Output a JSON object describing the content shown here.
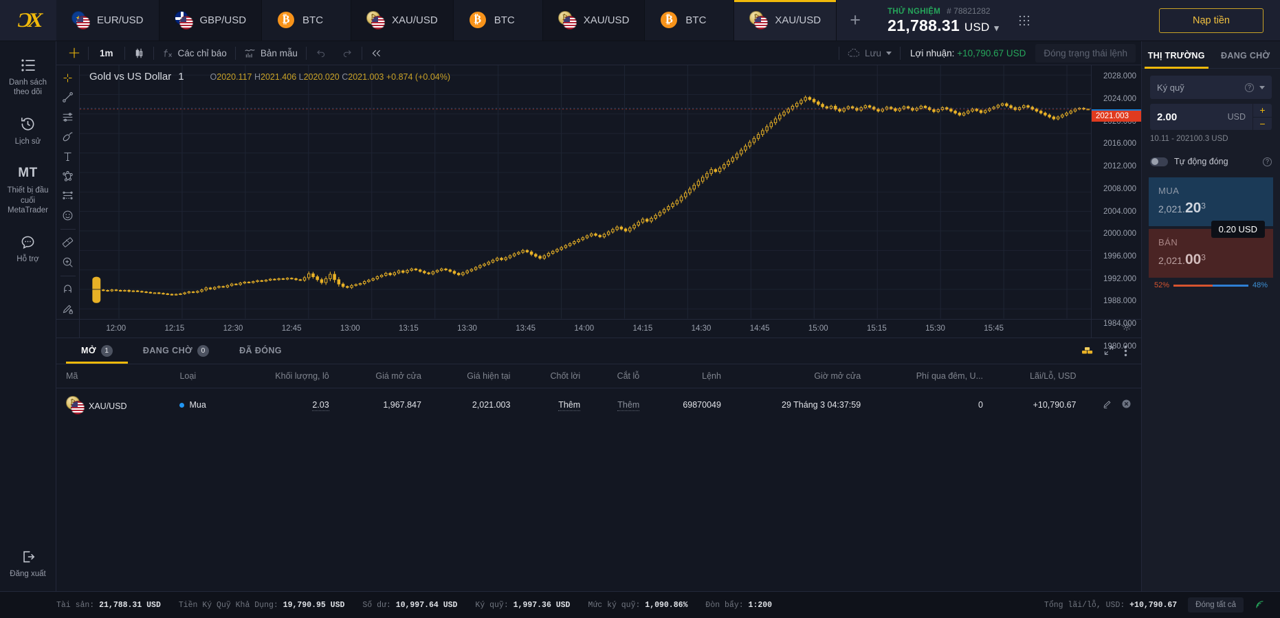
{
  "header": {
    "logo": "ex-logo",
    "tabs": [
      {
        "label": "EUR/USD",
        "icon": "eurusd-pair-icon",
        "active": false
      },
      {
        "label": "GBP/USD",
        "icon": "gbpusd-pair-icon",
        "active": false
      },
      {
        "label": "BTC",
        "icon": "btc-coin-icon",
        "active": false
      },
      {
        "label": "XAU/USD",
        "icon": "xauusd-pair-icon",
        "active": false
      },
      {
        "label": "BTC",
        "icon": "btc-coin-icon",
        "active": false
      },
      {
        "label": "XAU/USD",
        "icon": "xauusd-pair-icon",
        "active": false
      },
      {
        "label": "BTC",
        "icon": "btc-coin-icon",
        "active": false
      },
      {
        "label": "XAU/USD",
        "icon": "xauusd-pair-icon",
        "active": true
      }
    ],
    "add_tab": "+",
    "account_type": "THỬ NGHIỆM",
    "account_id": "# 78821282",
    "balance": "21,788.31",
    "balance_currency": "USD",
    "balance_caret": "▾",
    "apps_icon": "apps-grid-icon",
    "deposit_label": "Nạp tiền"
  },
  "sidebar": {
    "items": [
      {
        "label": "Danh sách theo dõi",
        "icon": "watchlist-icon"
      },
      {
        "label": "Lịch sử",
        "icon": "history-icon"
      },
      {
        "label": "Thiết bị đầu cuối MetaTrader",
        "icon": "mt-terminal-icon",
        "badge": "MT"
      },
      {
        "label": "Hỗ trợ",
        "icon": "support-chat-icon"
      }
    ],
    "logout": {
      "label": "Đăng xuất",
      "icon": "logout-icon"
    }
  },
  "chart_toolbar": {
    "crosshair_icon": "crosshair-icon",
    "timeframe": "1m",
    "chart_type_icon": "candlestick-type-icon",
    "indicators_label": "Các chỉ báo",
    "indicators_icon": "fx-icon",
    "templates_label": "Bản mẫu",
    "templates_icon": "template-icon",
    "undo_icon": "undo-icon",
    "redo_icon": "redo-icon",
    "replay_icon": "replay-icon",
    "save_label": "Lưu",
    "save_icon": "cloud-icon",
    "profit_label": "Lợi nhuận:",
    "profit_value": "+10,790.67 USD",
    "close_position_label": "Đóng trạng thái lệnh"
  },
  "draw_tools": [
    {
      "icon": "crosshair-cursor-icon",
      "active": true
    },
    {
      "icon": "trend-line-icon",
      "active": false
    },
    {
      "icon": "horizontal-lines-icon",
      "active": false
    },
    {
      "icon": "brush-icon",
      "active": false
    },
    {
      "icon": "text-icon",
      "active": false
    },
    {
      "icon": "pitchfork-icon",
      "active": false
    },
    {
      "icon": "fib-retracement-icon",
      "active": false
    },
    {
      "icon": "emoji-icon",
      "active": false
    },
    {
      "icon": "measure-ruler-icon",
      "active": false
    },
    {
      "icon": "zoom-in-icon",
      "active": false
    },
    {
      "icon": "magnet-icon",
      "active": false
    },
    {
      "icon": "pencil-lock-icon",
      "active": false
    }
  ],
  "chart_data": {
    "type": "line",
    "title": "Gold vs US Dollar",
    "interval": "1",
    "ohlc": {
      "o_label": "O",
      "o": "2020.117",
      "h_label": "H",
      "h": "2021.406",
      "l_label": "L",
      "l": "2020.020",
      "c_label": "C",
      "c": "2021.003",
      "change": "+0.874 (+0.04%)"
    },
    "xlabel": "",
    "ylabel": "",
    "ylim": [
      1978,
      2030
    ],
    "y_ticks": [
      "2028.000",
      "2024.000",
      "2020.000",
      "2016.000",
      "2012.000",
      "2008.000",
      "2004.000",
      "2000.000",
      "1996.000",
      "1992.000",
      "1988.000",
      "1984.000",
      "1980.000"
    ],
    "x_ticks": [
      "12:00",
      "12:15",
      "12:30",
      "12:45",
      "13:00",
      "13:15",
      "13:30",
      "13:45",
      "14:00",
      "14:15",
      "14:30",
      "14:45",
      "15:00",
      "15:15",
      "15:30",
      "15:45"
    ],
    "grid": true,
    "price_tags": [
      {
        "value": "2021.203",
        "color": "#1e7fd4"
      },
      {
        "value": "2021.003",
        "color": "#e03b1f"
      }
    ],
    "series": [
      {
        "name": "XAU/USD 1m close",
        "values": [
          1983.9,
          1983.8,
          1983.7,
          1983.9,
          1983.8,
          1983.7,
          1983.8,
          1983.6,
          1983.7,
          1983.6,
          1983.5,
          1983.4,
          1983.3,
          1983.3,
          1983.2,
          1983.1,
          1983.0,
          1982.9,
          1983.0,
          1983.1,
          1983.3,
          1983.5,
          1983.4,
          1983.6,
          1983.9,
          1984.3,
          1984.1,
          1984.4,
          1984.6,
          1984.5,
          1984.8,
          1985.1,
          1985.0,
          1985.3,
          1985.5,
          1985.4,
          1985.6,
          1985.8,
          1985.7,
          1985.9,
          1986.1,
          1986.0,
          1986.2,
          1986.1,
          1986.3,
          1986.2,
          1986.0,
          1985.9,
          1986.4,
          1987.2,
          1986.6,
          1986.0,
          1985.4,
          1986.2,
          1987.1,
          1986.0,
          1985.1,
          1984.6,
          1984.4,
          1984.8,
          1985.0,
          1985.2,
          1985.6,
          1985.9,
          1986.2,
          1986.6,
          1986.9,
          1987.3,
          1987.0,
          1987.4,
          1987.8,
          1987.5,
          1987.9,
          1988.2,
          1988.0,
          1987.7,
          1987.4,
          1987.2,
          1987.6,
          1987.9,
          1988.2,
          1988.0,
          1987.7,
          1987.3,
          1987.0,
          1987.4,
          1987.8,
          1988.1,
          1988.5,
          1988.9,
          1989.2,
          1989.6,
          1990.0,
          1990.4,
          1990.1,
          1990.5,
          1990.9,
          1991.3,
          1991.6,
          1992.0,
          1991.7,
          1991.2,
          1990.8,
          1990.4,
          1990.9,
          1991.4,
          1991.8,
          1992.2,
          1992.6,
          1993.0,
          1993.4,
          1993.8,
          1994.2,
          1994.6,
          1995.0,
          1995.4,
          1995.1,
          1994.8,
          1995.3,
          1995.8,
          1996.3,
          1996.8,
          1996.4,
          1996.0,
          1996.6,
          1997.2,
          1997.8,
          1998.4,
          1998.0,
          1998.6,
          1999.2,
          1999.8,
          2000.4,
          2001.0,
          2001.6,
          2002.2,
          2003.0,
          2003.8,
          2004.6,
          2005.4,
          2006.2,
          2007.0,
          2007.8,
          2008.6,
          2008.2,
          2008.9,
          2009.6,
          2010.3,
          2011.0,
          2011.8,
          2012.6,
          2013.4,
          2014.2,
          2015.0,
          2015.8,
          2016.6,
          2017.4,
          2018.2,
          2019.0,
          2019.8,
          2020.4,
          2021.0,
          2021.6,
          2022.2,
          2022.8,
          2023.4,
          2023.0,
          2022.5,
          2022.0,
          2021.5,
          2021.2,
          2021.6,
          2021.0,
          2020.6,
          2021.1,
          2021.5,
          2021.2,
          2020.8,
          2021.3,
          2021.7,
          2021.4,
          2021.0,
          2020.6,
          2021.0,
          2021.4,
          2021.1,
          2020.7,
          2021.1,
          2021.5,
          2021.2,
          2020.8,
          2021.2,
          2021.6,
          2021.3,
          2020.9,
          2020.5,
          2020.9,
          2021.3,
          2021.0,
          2020.6,
          2020.2,
          2019.8,
          2020.2,
          2020.6,
          2021.0,
          2020.7,
          2020.3,
          2020.7,
          2021.1,
          2021.4,
          2021.8,
          2022.1,
          2021.7,
          2021.3,
          2020.9,
          2021.3,
          2021.7,
          2021.4,
          2021.0,
          2020.6,
          2020.2,
          2019.8,
          2019.4,
          2019.0,
          2019.4,
          2019.8,
          2020.2,
          2020.6,
          2021.0,
          2021.2,
          2021.0,
          2021.003
        ]
      }
    ]
  },
  "orders": {
    "tabs": [
      {
        "label": "MỞ",
        "count": "1",
        "active": true
      },
      {
        "label": "ĐANG CHỜ",
        "count": "0",
        "active": false
      },
      {
        "label": "ĐÃ ĐÓNG",
        "count": "",
        "active": false
      }
    ],
    "tools": [
      {
        "icon": "gold-bars-icon"
      },
      {
        "icon": "collapse-arrows-icon"
      },
      {
        "icon": "more-vertical-icon"
      }
    ],
    "columns": [
      "Mã",
      "Loại",
      "Khối lượng, lô",
      "Giá mở cửa",
      "Giá hiện tại",
      "Chốt lời",
      "Cắt lỗ",
      "Lệnh",
      "Giờ mở cửa",
      "Phí qua đêm, U...",
      "Lãi/Lỗ, USD"
    ],
    "rows": [
      {
        "symbol": "XAU/USD",
        "type": "Mua",
        "volume": "2.03",
        "open_price": "1,967.847",
        "current_price": "2,021.003",
        "take_profit": "Thêm",
        "stop_loss": "Thêm",
        "order_id": "69870049",
        "open_time": "29 Tháng 3 04:37:59",
        "swap": "0",
        "pnl": "+10,790.67",
        "edit_icon": "edit-pencil-icon",
        "close_icon": "close-circle-icon"
      }
    ]
  },
  "trade_panel": {
    "tabs": [
      {
        "label": "THỊ TRƯỜNG",
        "active": true
      },
      {
        "label": "ĐANG CHỜ",
        "active": false
      }
    ],
    "mode_label": "Ký quỹ",
    "amount": "2.00",
    "amount_currency": "USD",
    "plus": "+",
    "minus": "−",
    "range_hint": "10.11 - 202100.3 USD",
    "autoclose_label": "Tự động đóng",
    "buy": {
      "label": "MUA",
      "price_main": "2,021.",
      "price_big": "20",
      "price_sup": "3"
    },
    "sell": {
      "label": "BÁN",
      "price_main": "2,021.",
      "price_big": "00",
      "price_sup": "3"
    },
    "spread_tooltip": "0.20 USD",
    "ratio_left": "52%",
    "ratio_right": "48%"
  },
  "status_bar": {
    "items": [
      {
        "label": "Tài sản:",
        "value": "21,788.31 USD"
      },
      {
        "label": "Tiền Ký Quỹ Khả Dụng:",
        "value": "19,790.95 USD"
      },
      {
        "label": "Số dư:",
        "value": "10,997.64 USD"
      },
      {
        "label": "Ký quỹ:",
        "value": "1,997.36 USD"
      },
      {
        "label": "Mức ký quỹ:",
        "value": "1,090.86%"
      },
      {
        "label": "Đòn bẩy:",
        "value": "1:200"
      }
    ],
    "total_label": "Tổng lãi/lỗ, USD:",
    "total_value": "+10,790.67",
    "close_all_label": "Đóng tất cả",
    "connection_icon": "signal-icon"
  }
}
